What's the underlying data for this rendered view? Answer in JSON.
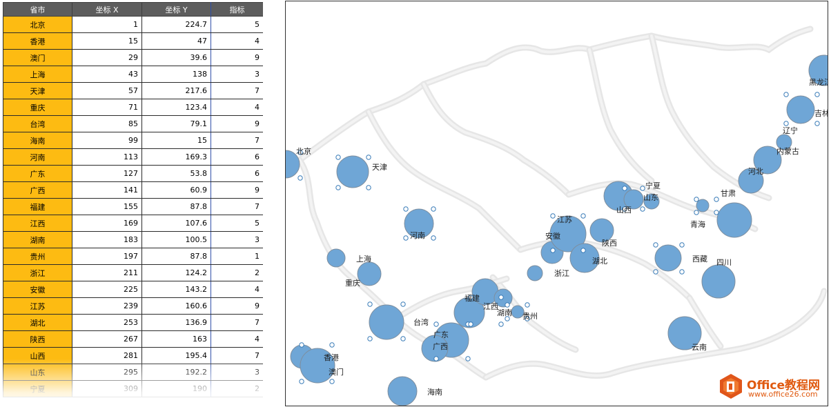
{
  "table": {
    "headers": [
      "省市",
      "坐标 X",
      "坐标 Y",
      "指标"
    ],
    "rows": [
      [
        "北京",
        "1",
        "224.7",
        "5"
      ],
      [
        "香港",
        "15",
        "47",
        "4"
      ],
      [
        "澳门",
        "29",
        "39.6",
        "9"
      ],
      [
        "上海",
        "43",
        "138",
        "3"
      ],
      [
        "天津",
        "57",
        "217.6",
        "7"
      ],
      [
        "重庆",
        "71",
        "123.4",
        "4"
      ],
      [
        "台湾",
        "85",
        "79.1",
        "9"
      ],
      [
        "海南",
        "99",
        "15",
        "7"
      ],
      [
        "河南",
        "113",
        "169.3",
        "6"
      ],
      [
        "广东",
        "127",
        "53.8",
        "6"
      ],
      [
        "广西",
        "141",
        "60.9",
        "9"
      ],
      [
        "福建",
        "155",
        "87.8",
        "7"
      ],
      [
        "江西",
        "169",
        "107.6",
        "5"
      ],
      [
        "湖南",
        "183",
        "100.5",
        "3"
      ],
      [
        "贵州",
        "197",
        "87.8",
        "1"
      ],
      [
        "浙江",
        "211",
        "124.2",
        "2"
      ],
      [
        "安徽",
        "225",
        "143.2",
        "4"
      ],
      [
        "江苏",
        "239",
        "160.6",
        "9"
      ],
      [
        "湖北",
        "253",
        "136.9",
        "7"
      ],
      [
        "陕西",
        "267",
        "163",
        "4"
      ],
      [
        "山西",
        "281",
        "195.4",
        "7"
      ],
      [
        "山东",
        "295",
        "192.2",
        "3"
      ],
      [
        "宁夏",
        "309",
        "190",
        "2"
      ]
    ]
  },
  "chart": {
    "bubble_color": "#6fa6d6",
    "bubble_stroke": "#7e8e9e",
    "map_color": "#e6e6e6",
    "labels": [
      "北京",
      "天津",
      "河南",
      "上海",
      "重庆",
      "台湾",
      "广东",
      "广西",
      "香港",
      "澳门",
      "海南",
      "福建",
      "江西",
      "湖南",
      "贵州",
      "浙江",
      "安徽",
      "江苏",
      "湖北",
      "陕西",
      "山西",
      "山东",
      "宁夏",
      "青海",
      "甘肃",
      "西藏",
      "四川",
      "云南",
      "河北",
      "内蒙古",
      "辽宁",
      "吉林",
      "黑龙江"
    ]
  },
  "logo": {
    "title": "Office教程网",
    "url": "www.office26.com"
  }
}
